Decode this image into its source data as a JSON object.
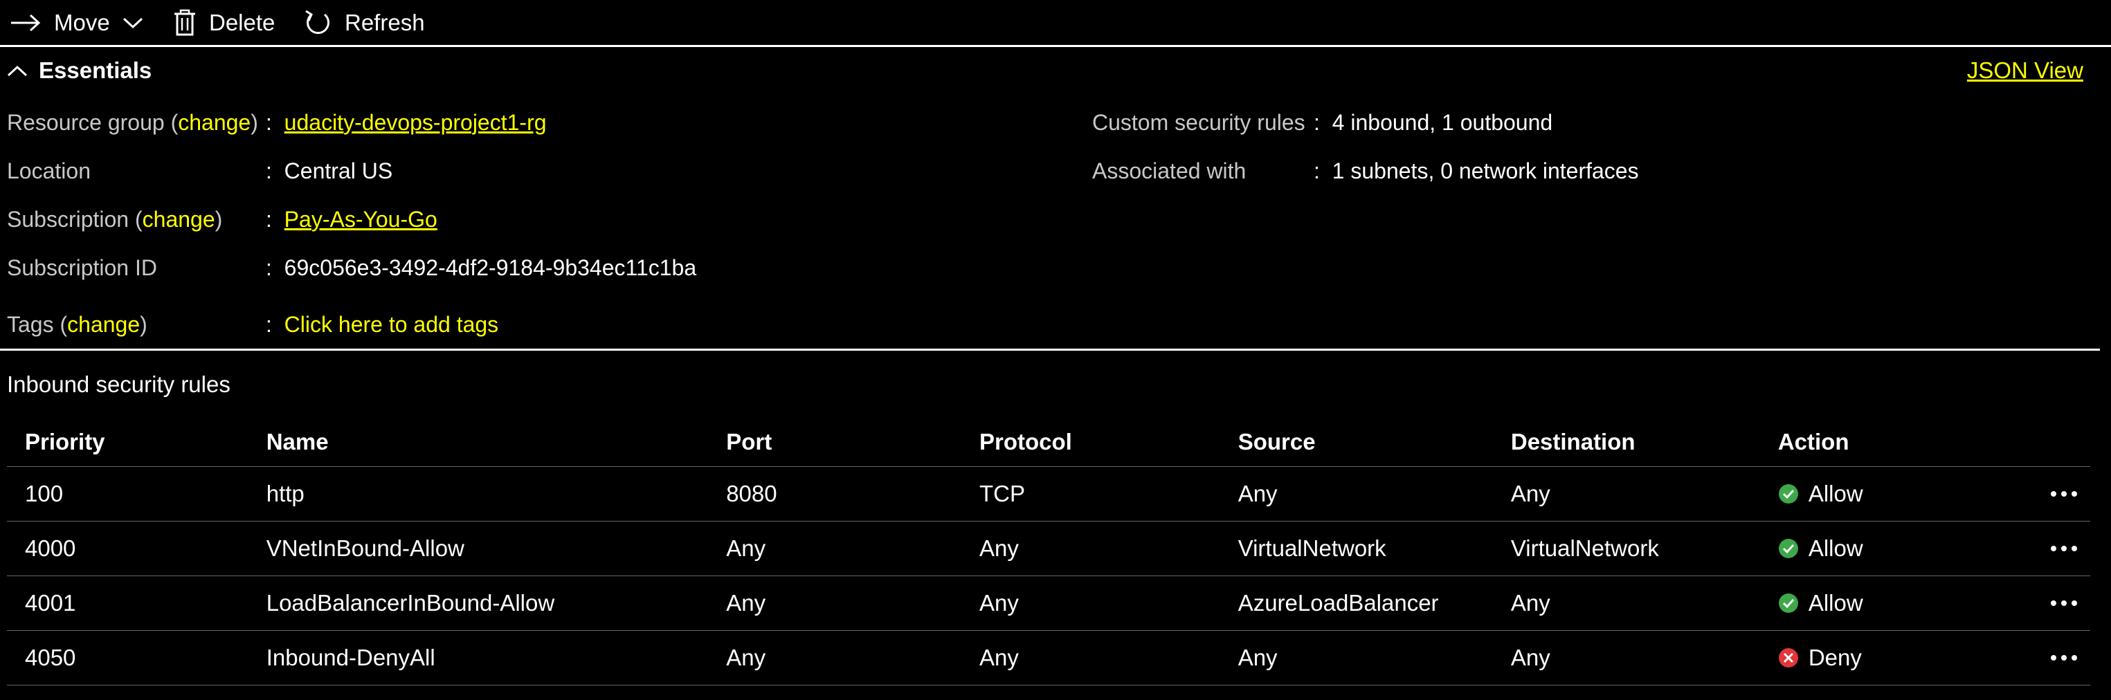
{
  "toolbar": {
    "move_label": "Move",
    "delete_label": "Delete",
    "refresh_label": "Refresh"
  },
  "essentials": {
    "title": "Essentials",
    "json_view_label": "JSON View",
    "left": {
      "resource_group": {
        "label": "Resource group",
        "change_label": "change",
        "value": "udacity-devops-project1-rg"
      },
      "location": {
        "label": "Location",
        "value": "Central US"
      },
      "subscription": {
        "label": "Subscription",
        "change_label": "change",
        "value": "Pay-As-You-Go"
      },
      "subscription_id": {
        "label": "Subscription ID",
        "value": "69c056e3-3492-4df2-9184-9b34ec11c1ba"
      },
      "tags": {
        "label": "Tags",
        "change_label": "change",
        "value": "Click here to add tags"
      }
    },
    "right": {
      "custom_security_rules": {
        "label": "Custom security rules",
        "value": "4 inbound, 1 outbound"
      },
      "associated_with": {
        "label": "Associated with",
        "value": "1 subnets, 0 network interfaces"
      }
    }
  },
  "inbound": {
    "title": "Inbound security rules",
    "columns": {
      "priority": "Priority",
      "name": "Name",
      "port": "Port",
      "protocol": "Protocol",
      "source": "Source",
      "destination": "Destination",
      "action": "Action"
    },
    "rows": [
      {
        "priority": "100",
        "name": "http",
        "port": "8080",
        "protocol": "TCP",
        "source": "Any",
        "destination": "Any",
        "action": "Allow",
        "action_icon": "check-circle-icon"
      },
      {
        "priority": "4000",
        "name": "VNetInBound-Allow",
        "port": "Any",
        "protocol": "Any",
        "source": "VirtualNetwork",
        "destination": "VirtualNetwork",
        "action": "Allow",
        "action_icon": "check-circle-icon"
      },
      {
        "priority": "4001",
        "name": "LoadBalancerInBound-Allow",
        "port": "Any",
        "protocol": "Any",
        "source": "AzureLoadBalancer",
        "destination": "Any",
        "action": "Allow",
        "action_icon": "check-circle-icon"
      },
      {
        "priority": "4050",
        "name": "Inbound-DenyAll",
        "port": "Any",
        "protocol": "Any",
        "source": "Any",
        "destination": "Any",
        "action": "Deny",
        "action_icon": "deny-circle-icon"
      }
    ]
  },
  "colors": {
    "background": "#000000",
    "text": "#ffffff",
    "label": "#c8c8c8",
    "link": "#ffff00",
    "allow": "#3ea84a",
    "deny": "#e2363a"
  },
  "icons": {
    "move": "arrow-right-icon",
    "move_dropdown": "chevron-down-icon",
    "delete": "trash-icon",
    "refresh": "refresh-icon",
    "essentials_toggle": "chevron-up-icon",
    "row_more": "more-horizontal-icon"
  }
}
